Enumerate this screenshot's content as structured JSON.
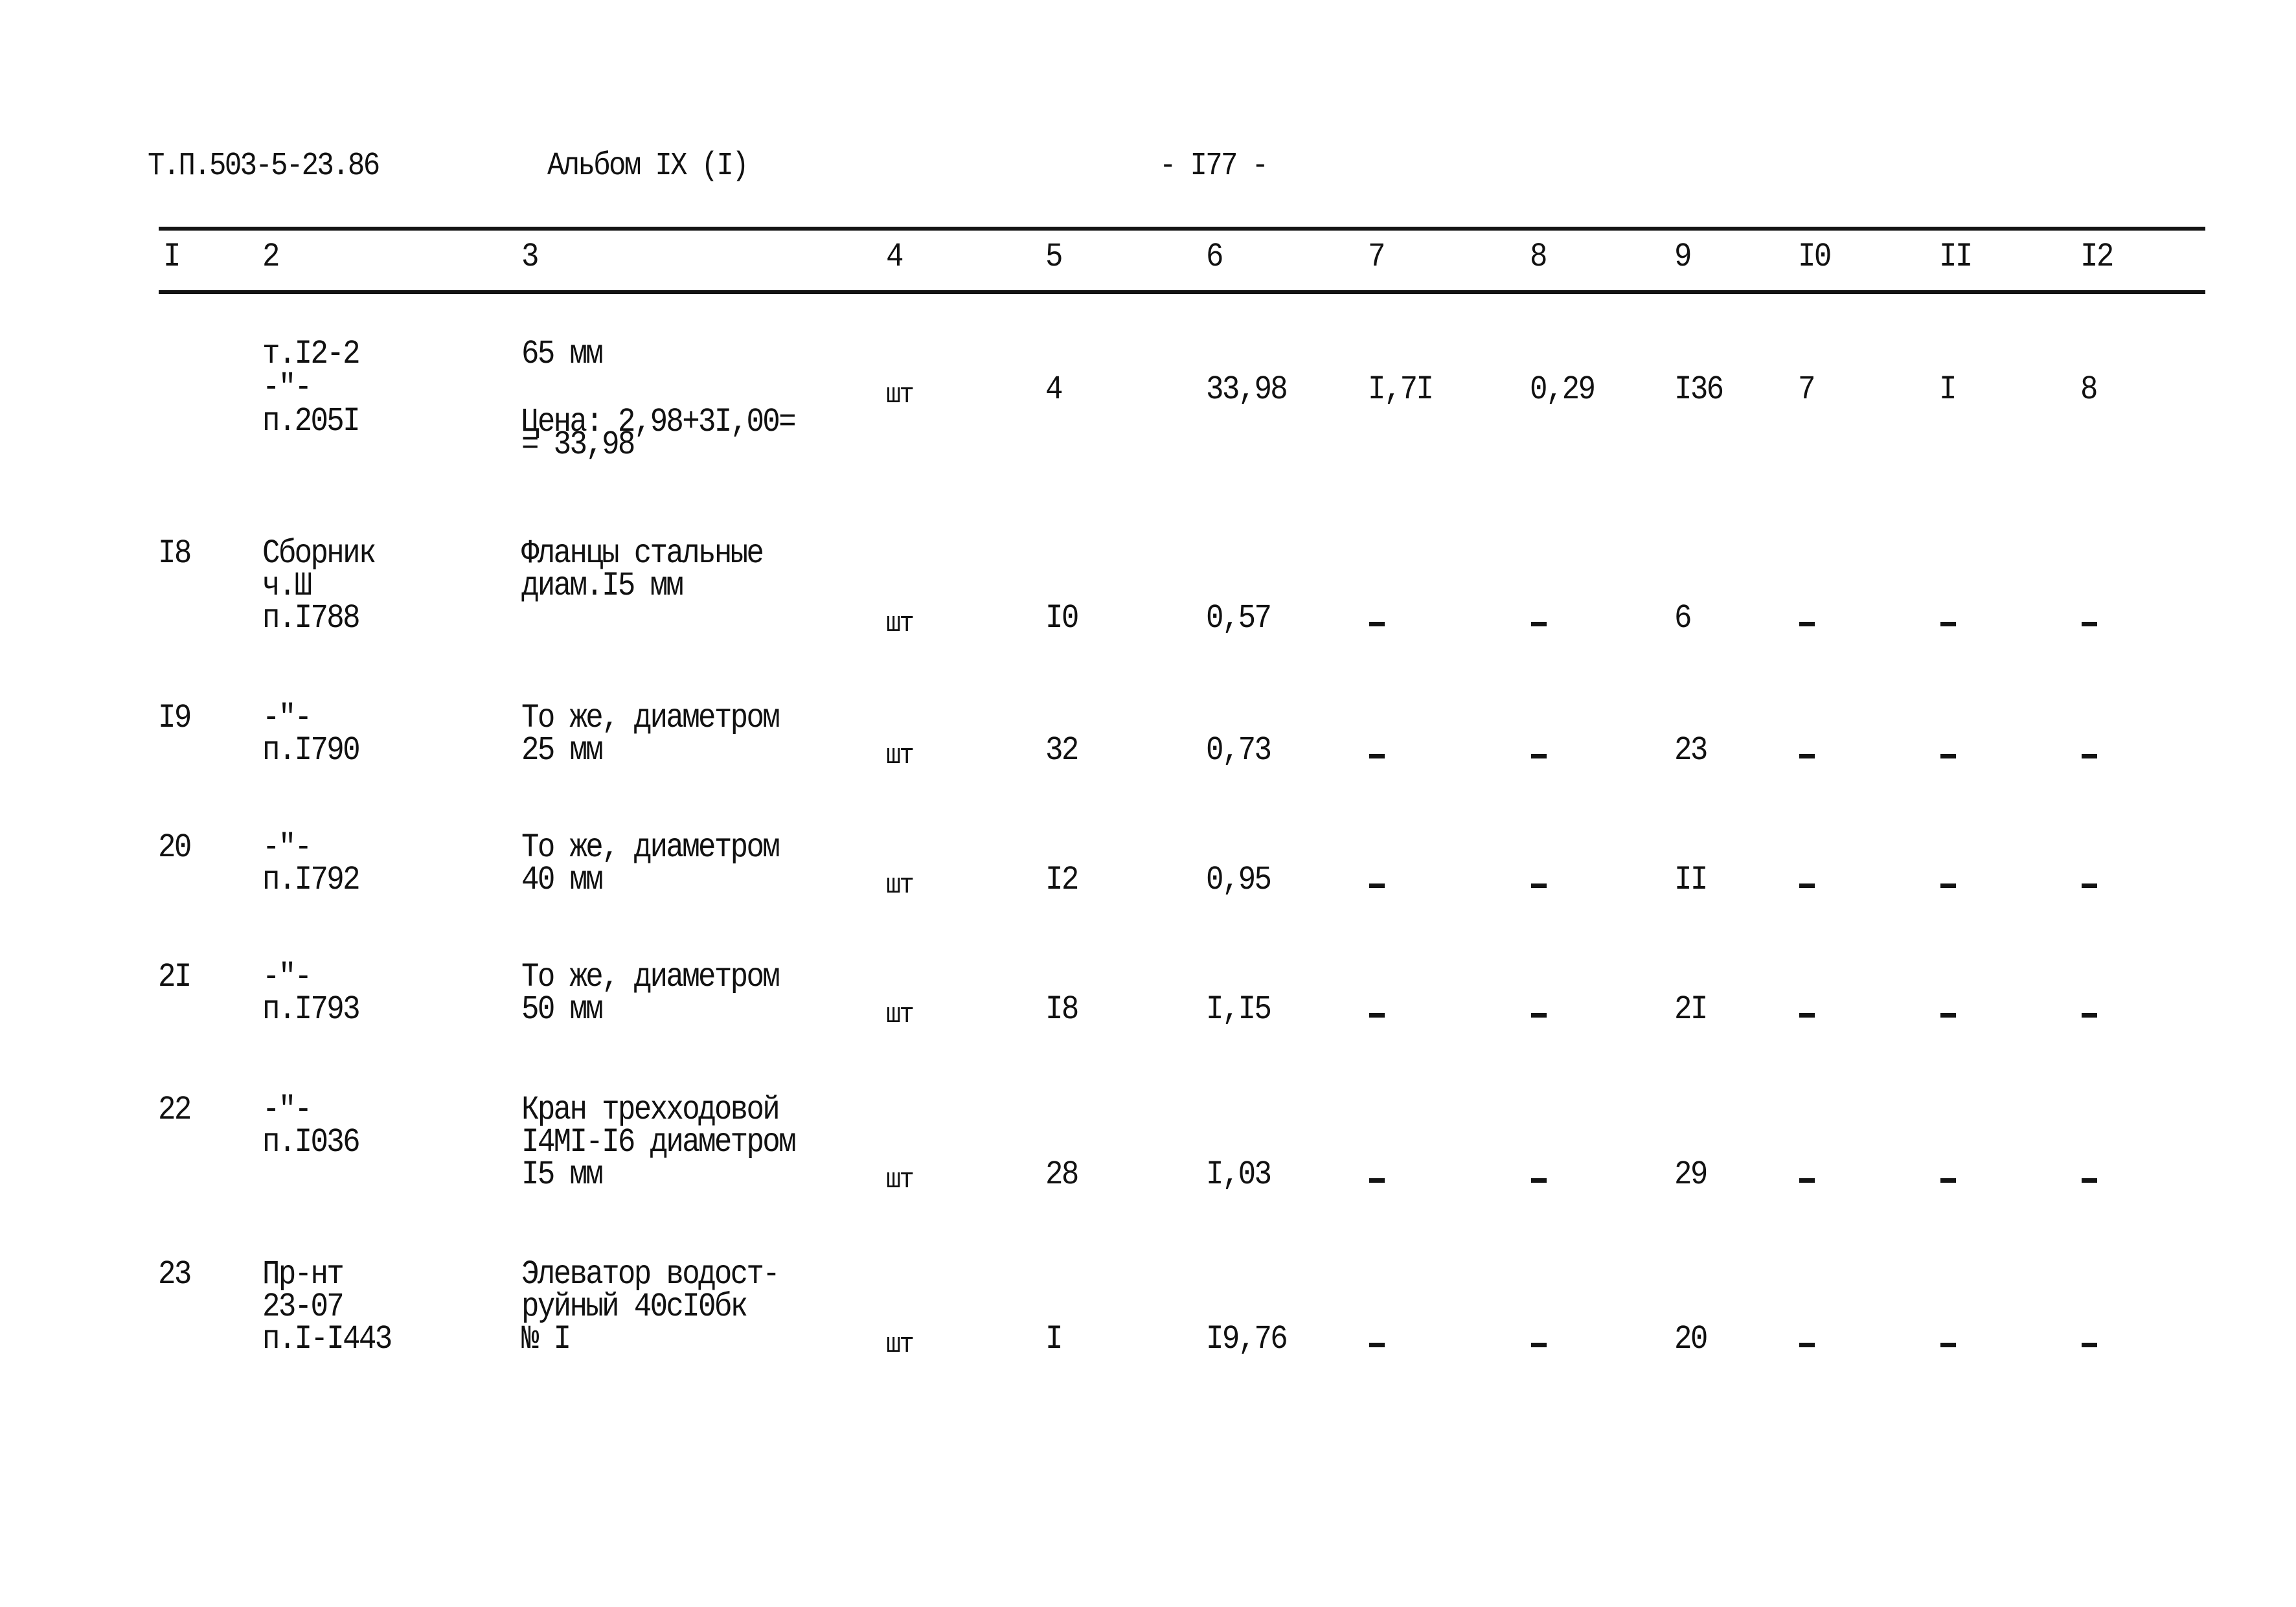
{
  "header": {
    "doc_code": "Т.П.503-5-23.86",
    "album": "Альбом IX (I)",
    "page_number": "- I77 -"
  },
  "columns": [
    "I",
    "2",
    "3",
    "4",
    "5",
    "6",
    "7",
    "8",
    "9",
    "I0",
    "II",
    "I2"
  ],
  "rows": [
    {
      "num": "",
      "source": [
        "т.I2-2",
        "-\"-",
        "п.205I"
      ],
      "description": [
        "65 мм",
        "",
        "Цена: 2,98+3I,00=",
        "= 33,98"
      ],
      "unit": "шт",
      "qty": "4",
      "c6": "33,98",
      "c7": "I,7I",
      "c8": "0,29",
      "c9": "I36",
      "c10": "7",
      "c11": "I",
      "c12": "8"
    },
    {
      "num": "I8",
      "source": [
        "Сборник",
        "ч.Ш",
        "п.I788"
      ],
      "description": [
        "Фланцы стальные",
        "диам.I5 мм"
      ],
      "unit": "шт",
      "qty": "I0",
      "c6": "0,57",
      "c7": "-",
      "c8": "-",
      "c9": "6",
      "c10": "-",
      "c11": "-",
      "c12": "-"
    },
    {
      "num": "I9",
      "source": [
        "-\"-",
        "п.I790"
      ],
      "description": [
        "То же, диаметром",
        "25 мм"
      ],
      "unit": "шт",
      "qty": "32",
      "c6": "0,73",
      "c7": "-",
      "c8": "-",
      "c9": "23",
      "c10": "-",
      "c11": "-",
      "c12": "-"
    },
    {
      "num": "20",
      "source": [
        "-\"-",
        "п.I792"
      ],
      "description": [
        "То же, диаметром",
        "40 мм"
      ],
      "unit": "шт",
      "qty": "I2",
      "c6": "0,95",
      "c7": "-",
      "c8": "-",
      "c9": "II",
      "c10": "-",
      "c11": "-",
      "c12": "-"
    },
    {
      "num": "2I",
      "source": [
        "-\"-",
        "п.I793"
      ],
      "description": [
        "То же, диаметром",
        "50 мм"
      ],
      "unit": "шт",
      "qty": "I8",
      "c6": "I,I5",
      "c7": "-",
      "c8": "-",
      "c9": "2I",
      "c10": "-",
      "c11": "-",
      "c12": "-"
    },
    {
      "num": "22",
      "source": [
        "-\"-",
        "п.I036"
      ],
      "description": [
        "Кран трехходовой",
        "I4MI-I6 диаметром",
        "I5 мм"
      ],
      "unit": "шт",
      "qty": "28",
      "c6": "I,03",
      "c7": "-",
      "c8": "-",
      "c9": "29",
      "c10": "-",
      "c11": "-",
      "c12": "-"
    },
    {
      "num": "23",
      "source": [
        "Пр-нт",
        "23-07",
        "п.I-I443"
      ],
      "description": [
        "Элеватор водост-",
        "руйный 40cI0бк",
        "№ I"
      ],
      "unit": "шт",
      "qty": "I",
      "c6": "I9,76",
      "c7": "-",
      "c8": "-",
      "c9": "20",
      "c10": "-",
      "c11": "-",
      "c12": "-"
    }
  ]
}
